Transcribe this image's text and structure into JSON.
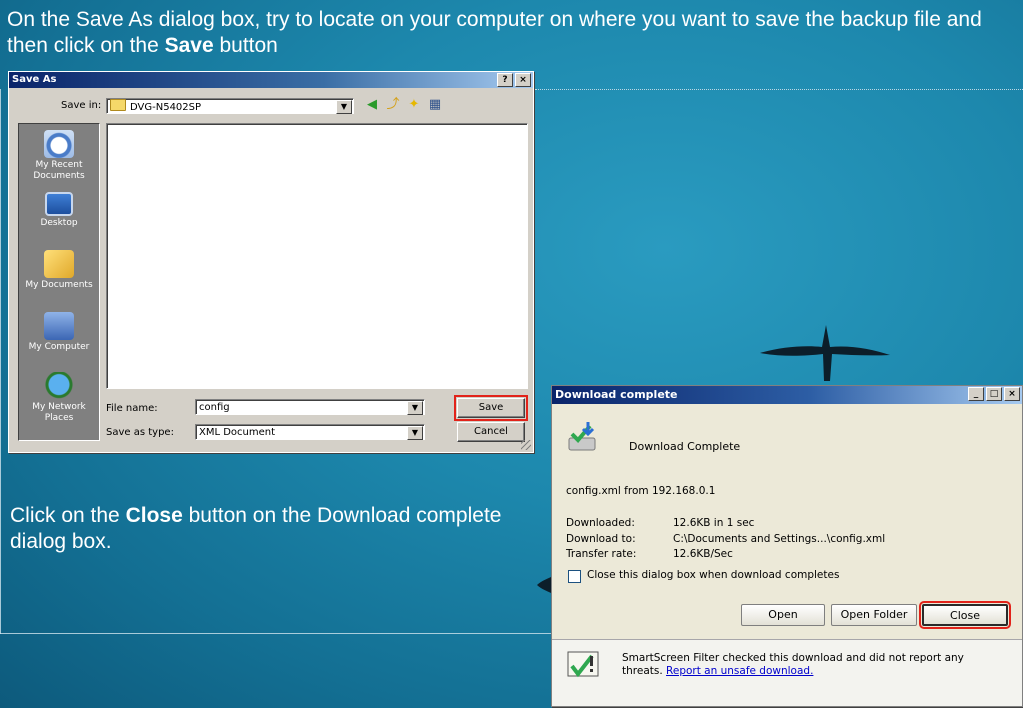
{
  "slide": {
    "instruction_top_pre": "On the Save As dialog box, try to locate on your computer on where you want to save the backup file and then click on the ",
    "instruction_top_bold": "Save",
    "instruction_top_post": " button",
    "instruction_bottom_pre": "Click on the ",
    "instruction_bottom_bold": "Close",
    "instruction_bottom_post": " button on the Download complete dialog box."
  },
  "save_as": {
    "title": "Save As",
    "help_btn": "?",
    "close_btn": "×",
    "save_in_label": "Save in:",
    "save_in_value": "DVG-N5402SP",
    "places": [
      "My Recent Documents",
      "Desktop",
      "My Documents",
      "My Computer",
      "My Network Places"
    ],
    "file_name_label": "File name:",
    "file_name_value": "config",
    "save_type_label": "Save as type:",
    "save_type_value": "XML Document",
    "save_button": "Save",
    "cancel_button": "Cancel"
  },
  "download": {
    "title": "Download complete",
    "heading": "Download Complete",
    "source": "config.xml from 192.168.0.1",
    "downloaded_label": "Downloaded:",
    "downloaded_value": "12.6KB in 1 sec",
    "download_to_label": "Download to:",
    "download_to_value": "C:\\Documents and Settings...\\config.xml",
    "transfer_label": "Transfer rate:",
    "transfer_value": "12.6KB/Sec",
    "close_when_done": "Close this dialog box when download completes",
    "open_button": "Open",
    "open_folder_button": "Open Folder",
    "close_button": "Close",
    "smartscreen_text": "SmartScreen Filter checked this download and did not report any threats.",
    "smartscreen_link": "Report an unsafe download."
  },
  "colors": {
    "highlight": "#e2231a",
    "titlebar": "#0a246a",
    "background": "#1d88ad"
  }
}
